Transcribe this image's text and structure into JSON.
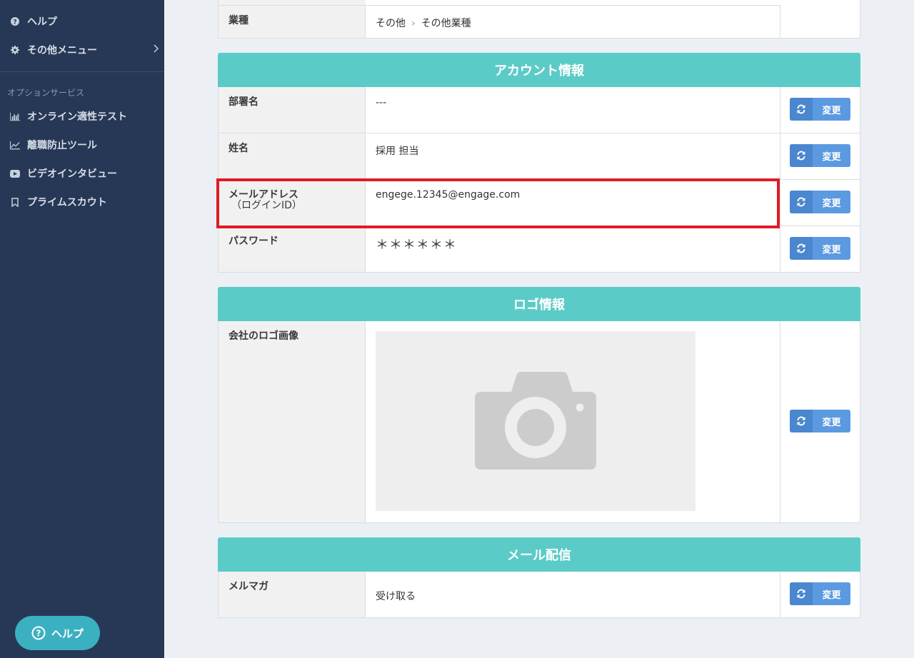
{
  "sidebar": {
    "items": [
      {
        "label": "ヘルプ",
        "icon": "question-circle-icon"
      },
      {
        "label": "その他メニュー",
        "icon": "gear-icon"
      }
    ],
    "section_title": "オプションサービス",
    "option_items": [
      {
        "label": "オンライン適性テスト",
        "icon": "bar-chart-icon"
      },
      {
        "label": "離職防止ツール",
        "icon": "line-chart-icon"
      },
      {
        "label": "ビデオインタビュー",
        "icon": "video-play-icon"
      },
      {
        "label": "プライムスカウト",
        "icon": "bookmark-icon"
      }
    ],
    "help_button": "ヘルプ"
  },
  "company": {
    "industry_label": "業種",
    "industry_parent": "その他",
    "industry_child": "その他業種"
  },
  "account": {
    "title": "アカウント情報",
    "rows": [
      {
        "label": "部署名",
        "value": "---"
      },
      {
        "label": "姓名",
        "value": "採用 担当"
      },
      {
        "label": "メールアドレス",
        "sublabel": "（ログインID）",
        "value": "engege.12345@engage.com"
      },
      {
        "label": "パスワード",
        "value": "＊＊＊＊＊＊"
      }
    ]
  },
  "logo": {
    "title": "ロゴ情報",
    "label": "会社のロゴ画像"
  },
  "mail": {
    "title": "メール配信",
    "label": "メルマガ",
    "value": "受け取る"
  },
  "change_label": "変更",
  "colors": {
    "sidebar_bg": "#273856",
    "header_teal": "#5bcbc7",
    "button_blue": "#5b9ae0",
    "highlight_red": "#e01b24"
  }
}
